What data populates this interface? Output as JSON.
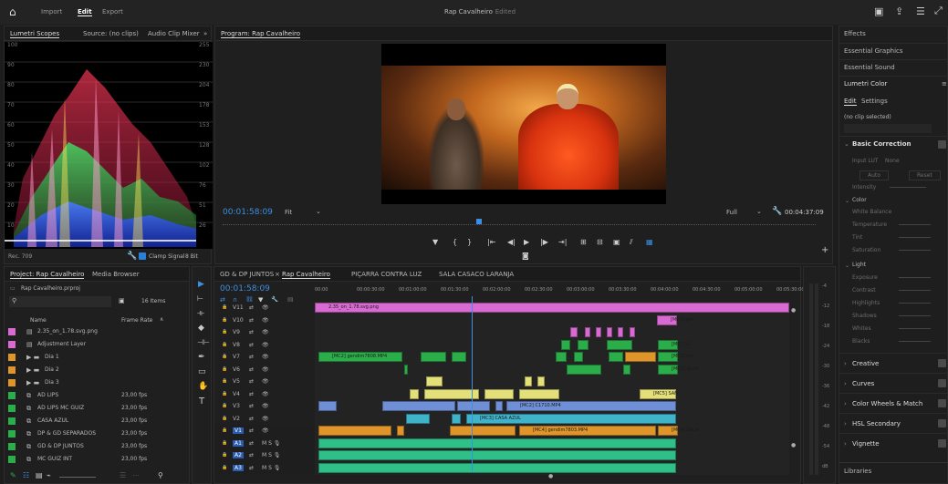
{
  "topbar": {
    "menu_import": "Import",
    "menu_edit": "Edit",
    "menu_export": "Export",
    "project_title": "Rap Cavalheiro",
    "edited_status": "- Edited"
  },
  "scopes": {
    "tabs": [
      "Lumetri Scopes",
      "Source: (no clips)",
      "Audio Clip Mixer"
    ],
    "tabs_prefix": "»",
    "left_scale": [
      "100",
      "90",
      "80",
      "70",
      "60",
      "50",
      "40",
      "30",
      "20",
      "10"
    ],
    "right_scale": [
      "255",
      "230",
      "204",
      "178",
      "153",
      "128",
      "102",
      "76",
      "51",
      "26"
    ],
    "rec_label": "Rec. 709",
    "clamp_label": "Clamp Signal",
    "bit_label": "8 Bit"
  },
  "program": {
    "title": "Program: Rap Cavalheiro",
    "timecode": "00:01:58:09",
    "fit": "Fit",
    "quality": "Full",
    "duration": "00:04:37:09",
    "playhead_fraction": 0.427
  },
  "project": {
    "tabs": [
      "Project: Rap Cavalheiro",
      "Media Browser"
    ],
    "file": "Rap Cavalheiro.prproj",
    "item_count": "16 Items",
    "col_name": "Name",
    "col_rate": "Frame Rate",
    "items": [
      {
        "name": "2.35_on_1.78.svg.png",
        "rate": "",
        "color": "#d86ad2"
      },
      {
        "name": "Adjustment Layer",
        "rate": "",
        "color": "#d86ad2"
      },
      {
        "name": "Dia 1",
        "rate": "",
        "color": "#e0952b"
      },
      {
        "name": "Dia 2",
        "rate": "",
        "color": "#e0952b"
      },
      {
        "name": "Dia 3",
        "rate": "",
        "color": "#e0952b"
      },
      {
        "name": "AD LIPS",
        "rate": "23,00 fps",
        "color": "#2bae4a"
      },
      {
        "name": "AD LIPS MC GUIZ",
        "rate": "23,00 fps",
        "color": "#2bae4a"
      },
      {
        "name": "CASA AZUL",
        "rate": "23,00 fps",
        "color": "#2bae4a"
      },
      {
        "name": "DP & GD SEPARADOS",
        "rate": "23,00 fps",
        "color": "#2bae4a"
      },
      {
        "name": "GD & DP JUNTOS",
        "rate": "23,00 fps",
        "color": "#2bae4a"
      },
      {
        "name": "MC GUIZ INT",
        "rate": "23,00 fps",
        "color": "#2bae4a"
      }
    ]
  },
  "timeline": {
    "tabs": [
      "GD & DP JUNTOS",
      "Rap Cavalheiro",
      "PIÇARRA CONTRA LUZ",
      "SALA CASACO LARANJA"
    ],
    "timecode": "00:01:58:09",
    "ruler": [
      "00:00",
      "00:00:30:00",
      "00:01:00:00",
      "00:01:30:00",
      "00:02:00:00",
      "00:02:30:00",
      "00:03:00:00",
      "00:03:30:00",
      "00:04:00:00",
      "00:04:30:00",
      "00:05:00:00",
      "00:05:30:00"
    ],
    "video_tracks": [
      "V11",
      "V10",
      "V9",
      "V8",
      "V7",
      "V6",
      "V5",
      "V4",
      "V3",
      "V2",
      "V1"
    ],
    "audio_tracks": [
      "A1",
      "A2",
      "A3"
    ],
    "clip_labels": {
      "top": "2.35_on_1.78.svg.png",
      "mc1": "[MC1] ger",
      "mc7": "[MC7] G",
      "mc2_right": "[MC2] ger",
      "mc2_left": "[MC2] gendim7808.MP4",
      "mc2_v6": "[MC2] gend",
      "mc5": "[MC5] SAN",
      "mc2_c1": "[MC2] C1710.MP4",
      "mc3": "[MC3] CASA AZUL",
      "mc4": "[MC4] gendim7803.MP4",
      "mc4_sala": "[MC4] SALA"
    },
    "meter_scale": [
      "-4",
      "-12",
      "-18",
      "-24",
      "-30",
      "-36",
      "-42",
      "-48",
      "-54",
      "dB"
    ],
    "playhead_fraction": 0.33
  },
  "right_panel": {
    "sections": [
      "Effects",
      "Essential Graphics",
      "Essential Sound",
      "Lumetri Color"
    ],
    "subtabs": [
      "Edit",
      "Settings"
    ],
    "no_clip": "(no clip selected)",
    "basic_correction": "Basic Correction",
    "input_lut": "Input LUT",
    "none": "None",
    "auto": "Auto",
    "reset": "Reset",
    "intensity": "Intensity",
    "color": "Color",
    "white_balance": "White Balance",
    "color_controls": [
      "Temperature",
      "Tint",
      "Saturation"
    ],
    "light": "Light",
    "light_controls": [
      "Exposure",
      "Contrast",
      "Highlights",
      "Shadows",
      "Whites",
      "Blacks"
    ],
    "collapsed": [
      "Creative",
      "Curves",
      "Color Wheels & Match",
      "HSL Secondary",
      "Vignette"
    ],
    "libraries": "Libraries"
  }
}
